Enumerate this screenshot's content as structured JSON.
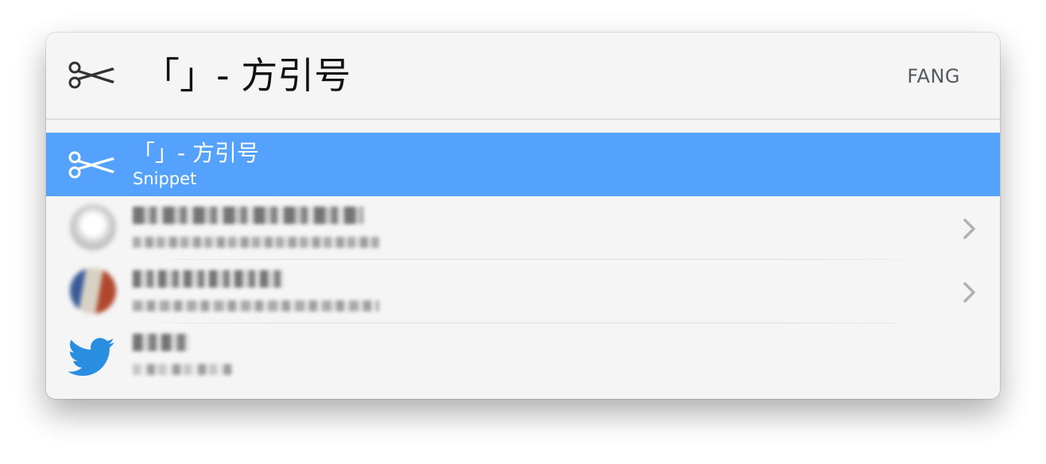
{
  "search": {
    "query": "「」- 方引号",
    "keyword_hint": "FANG",
    "icon": "scissors-icon"
  },
  "results": [
    {
      "title": "「」- 方引号",
      "subtitle": "Snippet",
      "icon": "scissors-icon",
      "selected": true
    },
    {
      "title": "",
      "subtitle": "",
      "icon": "avatar-blurred",
      "has_chevron": true
    },
    {
      "title": "",
      "subtitle": "",
      "icon": "avatar-blurred",
      "has_chevron": true
    },
    {
      "title": "",
      "subtitle": "",
      "icon": "twitter-bird-icon"
    }
  ],
  "colors": {
    "selection": "#54a2fd",
    "window_bg": "#f5f5f5",
    "hint_text": "#555a60"
  }
}
